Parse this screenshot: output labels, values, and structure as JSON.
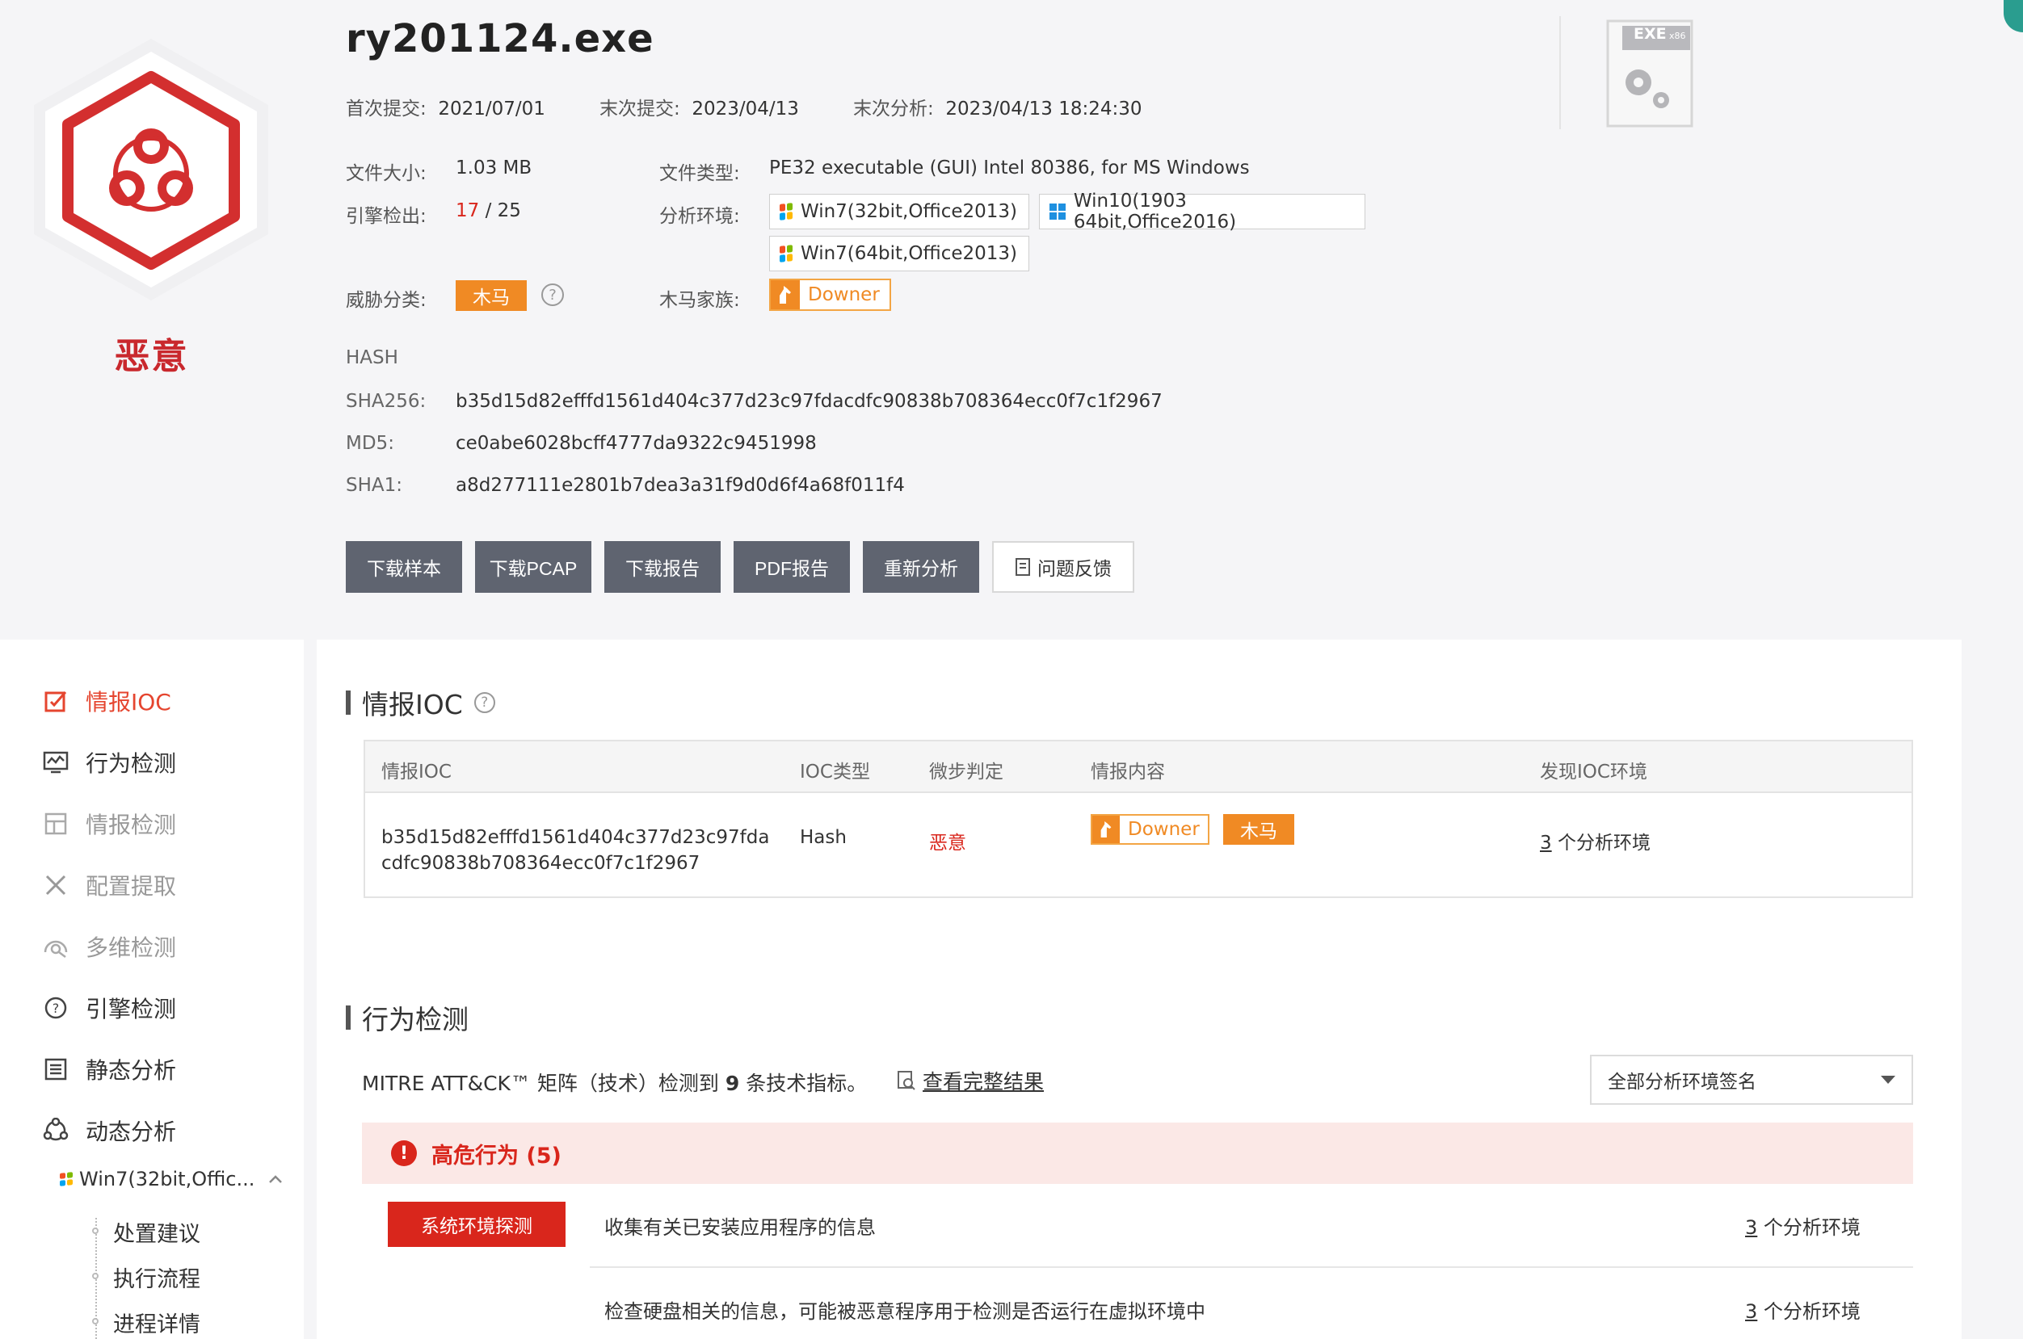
{
  "file": {
    "name": "ry201124.exe",
    "verdict": "恶意",
    "first_submit_label": "首次提交:",
    "first_submit": "2021/07/01",
    "last_submit_label": "末次提交:",
    "last_submit": "2023/04/13",
    "last_analysis_label": "末次分析:",
    "last_analysis": "2023/04/13 18:24:30",
    "size_label": "文件大小:",
    "size": "1.03 MB",
    "type_label": "文件类型:",
    "type": "PE32 executable (GUI) Intel 80386, for MS Windows",
    "engines_label": "引擎检出:",
    "engines_detected": "17",
    "engines_sep": " / ",
    "engines_total": "25",
    "env_label": "分析环境:",
    "environments": [
      "Win7(32bit,Office2013)",
      "Win10(1903 64bit,Office2016)",
      "Win7(64bit,Office2013)"
    ],
    "threat_label": "威胁分类:",
    "threat_class": "木马",
    "family_label": "木马家族:",
    "family": "Downer",
    "exe_badge": "EXE",
    "exe_arch": "x86",
    "colors": {
      "danger": "#d9261c",
      "orange": "#f08a24",
      "button": "#5f6470"
    }
  },
  "hash": {
    "heading": "HASH",
    "sha256_label": "SHA256:",
    "sha256": "b35d15d82efffd1561d404c377d23c97fdacdfc90838b708364ecc0f7c1f2967",
    "md5_label": "MD5:",
    "md5": "ce0abe6028bcff4777da9322c9451998",
    "sha1_label": "SHA1:",
    "sha1": "a8d277111e2801b7dea3a31f9d0d6f4a68f011f4"
  },
  "actions": {
    "download_sample": "下载样本",
    "download_pcap": "下载PCAP",
    "download_report": "下载报告",
    "pdf_report": "PDF报告",
    "reanalyze": "重新分析",
    "feedback": "问题反馈"
  },
  "sidebar": {
    "items": [
      {
        "label": "情报IOC",
        "icon": "edit-check-icon"
      },
      {
        "label": "行为检测",
        "icon": "monitor-chart-icon"
      },
      {
        "label": "情报检测",
        "icon": "layout-icon"
      },
      {
        "label": "配置提取",
        "icon": "tools-icon"
      },
      {
        "label": "多维检测",
        "icon": "radar-icon"
      },
      {
        "label": "引擎检测",
        "icon": "question-circle-icon"
      },
      {
        "label": "静态分析",
        "icon": "list-icon"
      },
      {
        "label": "动态分析",
        "icon": "cycle-icon"
      }
    ],
    "env_item": "Win7(32bit,Offic...",
    "tree": [
      "处置建议",
      "执行流程",
      "进程详情"
    ]
  },
  "ioc": {
    "title": "情报IOC",
    "headers": [
      "情报IOC",
      "IOC类型",
      "微步判定",
      "情报内容",
      "发现IOC环境"
    ],
    "row": {
      "ioc_line1": "b35d15d82efffd1561d404c377d23c97fda",
      "ioc_line2": "cdfc90838b708364ecc0f7c1f2967",
      "type": "Hash",
      "verdict": "恶意",
      "family": "Downer",
      "threat": "木马",
      "env_count": "3",
      "env_suffix": " 个分析环境"
    }
  },
  "behavior": {
    "title": "行为检测",
    "mitre_prefix": "MITRE ATT&CK™ 矩阵（技术）检测到 ",
    "mitre_count": "9",
    "mitre_suffix": " 条技术指标。",
    "full_result_link": "查看完整结果",
    "env_select": "全部分析环境签名",
    "risk_heading": "高危行为 (5)",
    "tactic": "系统环境探测",
    "rows": [
      {
        "text": "收集有关已安装应用程序的信息",
        "env_count": "3",
        "env_suffix": " 个分析环境"
      },
      {
        "text": "检查硬盘相关的信息，可能被恶意程序用于检测是否运行在虚拟环境中",
        "env_count": "3",
        "env_suffix": " 个分析环境"
      }
    ]
  }
}
